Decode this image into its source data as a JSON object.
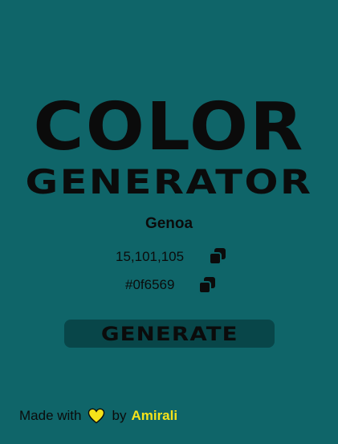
{
  "title": {
    "line1": "COLOR",
    "line2": "GENERATOR"
  },
  "color": {
    "name": "Genoa",
    "rgb": "15,101,105",
    "hex": "#0f6569"
  },
  "icons": {
    "copy": "copy-icon",
    "heart": "heart-icon"
  },
  "button": {
    "label": "GENERATE"
  },
  "footer": {
    "made_with": "Made with",
    "by": "by",
    "author": "Amirali"
  },
  "colors": {
    "background": "#0f6569",
    "button_bg": "#084649",
    "text": "#0b0b0b",
    "heart": "#f5e31a",
    "author": "#f5e31a"
  }
}
